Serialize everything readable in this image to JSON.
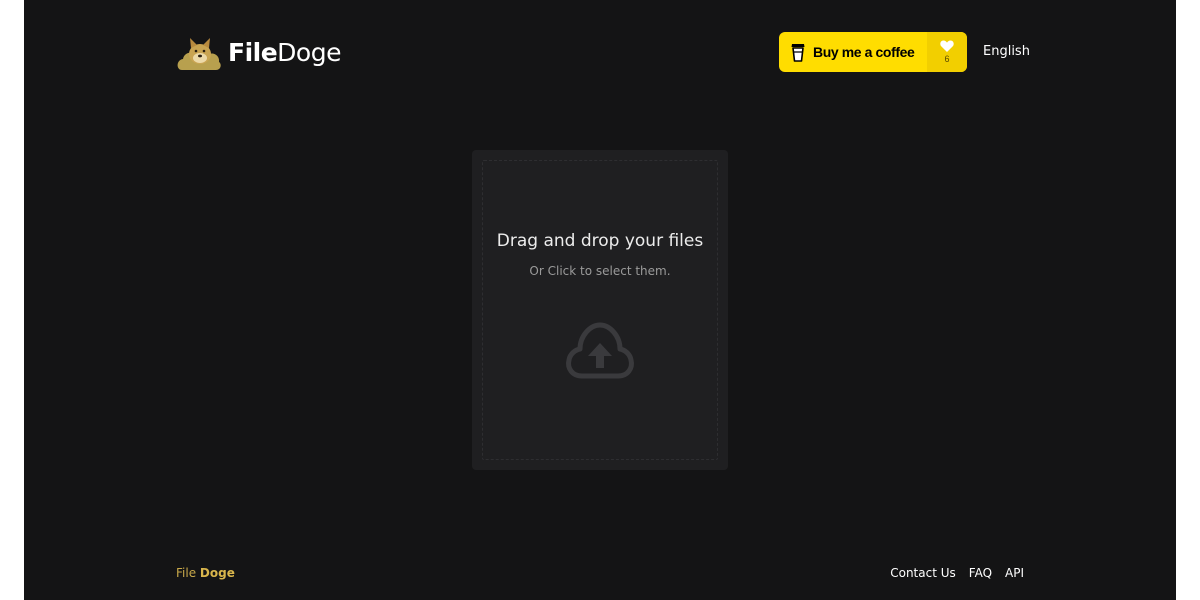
{
  "header": {
    "logo_part1": "File",
    "logo_part2": "Doge",
    "coffee_button": {
      "label": "Buy me a coffee",
      "count": "6"
    },
    "language": "English"
  },
  "dropzone": {
    "title": "Drag and drop your files",
    "subtitle": "Or Click to select them."
  },
  "footer": {
    "brand_part1": "File",
    "brand_part2": "Doge",
    "links": [
      "Contact Us",
      "FAQ",
      "API"
    ]
  },
  "colors": {
    "background": "#141415",
    "accent_yellow": "#ffdd00",
    "brand_gold": "#d9b64c",
    "dropzone_bg": "#1f1f21"
  },
  "icons": {
    "logo": "doge-cloud-icon",
    "coffee": "coffee-cup-icon",
    "heart": "heart-icon",
    "upload": "cloud-upload-icon"
  }
}
